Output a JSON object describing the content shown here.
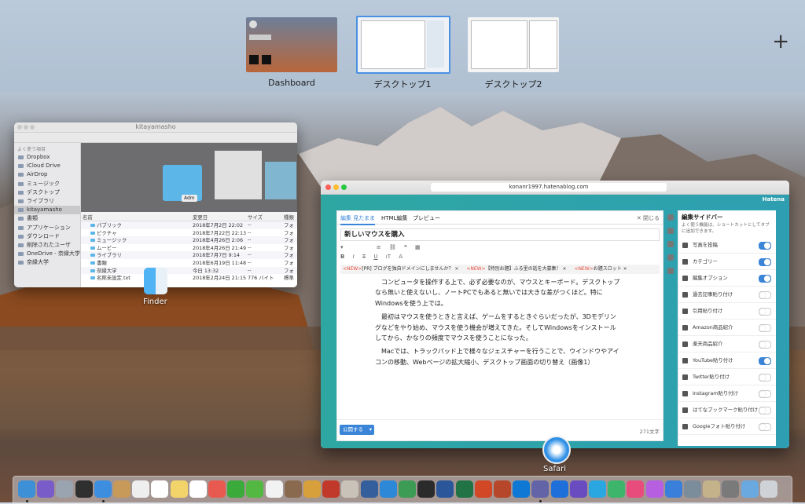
{
  "spaces": {
    "items": [
      {
        "label": "Dashboard"
      },
      {
        "label": "デスクトップ1"
      },
      {
        "label": "デスクトップ2"
      }
    ],
    "add_glyph": "+"
  },
  "finder": {
    "title": "kitayamasho",
    "sidebar_header": "よく使う項目",
    "sidebar": [
      "Dropbox",
      "iCloud Drive",
      "AirDrop",
      "ミュージック",
      "デスクトップ",
      "ライブラリ",
      "kitayamasho",
      "書類",
      "アプリケーション",
      "ダウンロード",
      "削除されたユーザ",
      "OneDrive - 奈縁大学",
      "奈縁大学"
    ],
    "preview_label": "Adm",
    "columns": [
      "名前",
      "変更日",
      "サイズ",
      "種類"
    ],
    "rows": [
      [
        "パブリック",
        "2018年7月2日 22:02",
        "--",
        "フォ"
      ],
      [
        "ピクチャ",
        "2018年7月22日 22:13",
        "--",
        "フォ"
      ],
      [
        "ミュージック",
        "2018年4月26日 2:06",
        "--",
        "フォ"
      ],
      [
        "ムービー",
        "2018年4月26日 21:49",
        "--",
        "フォ"
      ],
      [
        "ライブラリ",
        "2018年7月7日 9:14",
        "--",
        "フォ"
      ],
      [
        "書類",
        "2018年6月19日 11:48",
        "--",
        "フォ"
      ],
      [
        "奈縁大学",
        "今日 13:32",
        "--",
        "フォ"
      ],
      [
        "名称未設定.txt",
        "2018年2月24日 21:15",
        "776 バイト",
        "標準"
      ]
    ]
  },
  "app_labels": {
    "finder": "Finder",
    "safari": "Safari"
  },
  "safari": {
    "url": "konanr1997.hatenablog.com",
    "tab_brand": "Hatena",
    "editor": {
      "tabs": [
        "編集 見たまま",
        "HTML編集",
        "プレビュー"
      ],
      "close_label": "✕ 閉じる",
      "post_title": "新しいマウスを購入",
      "news": [
        {
          "tag": "<NEW>",
          "text": "[PR] ブログを独自ドメインにしませんか？ ×"
        },
        {
          "tag": "<NEW>",
          "text": "【特別お題】ふる里の話を大募集！ ×"
        },
        {
          "tag": "<NEW>",
          "text": "お題スロット ×"
        }
      ],
      "paragraphs": [
        "コンピュータを操作する上で、必ず必要なのが、マウスとキーボード。デスクトップなら無いと使えないし、ノートPCでもあると無いでは大きな差がつくほど。特にWindowsを使う上では。",
        "最初はマウスを使うときと言えば、ゲームをするときぐらいだったが、3Dモデリングなどをやり始め、マウスを使う機会が増えてきた。そしてWindowsをインストールしてから、かなりの頻度でマウスを使うことになった。",
        "Macでは、トラックパッド上で様々なジェスチャーを行うことで、ウインドウやアイコンの移動、Webページの拡大縮小、デスクトップ画面の切り替え（画像1）"
      ],
      "publish_label": "公開する",
      "word_count": "271文字"
    },
    "sidebar": {
      "title": "編集サイドバー",
      "note": "よく使う機能は、ショートカットとしてタブに追加できます。",
      "items": [
        {
          "label": "写真を投稿",
          "on": true
        },
        {
          "label": "カテゴリー",
          "on": true
        },
        {
          "label": "編集オプション",
          "on": true
        },
        {
          "label": "過去記事貼り付け",
          "on": false
        },
        {
          "label": "引用貼り付け",
          "on": false
        },
        {
          "label": "Amazon商品紹介",
          "on": false
        },
        {
          "label": "楽天商品紹介",
          "on": false
        },
        {
          "label": "YouTube貼り付け",
          "on": true
        },
        {
          "label": "Twitter貼り付け",
          "on": false
        },
        {
          "label": "Instagram貼り付け",
          "on": false
        },
        {
          "label": "はてなブックマーク貼り付け",
          "on": false
        },
        {
          "label": "Googleフォト貼り付け",
          "on": false
        }
      ]
    }
  },
  "dock": {
    "colors": [
      "#3d8fd6",
      "#7a5cc9",
      "#9aa3b0",
      "#2f2f2f",
      "#3e8ee0",
      "#c79a5a",
      "#eeeeee",
      "#ffffff",
      "#f3d46b",
      "#ffffff",
      "#e85a4f",
      "#3aaa3a",
      "#52b842",
      "#f2f2f2",
      "#8a6a4f",
      "#d8a03a",
      "#c0392b",
      "#c8c2b8",
      "#355e9c",
      "#2d88d8",
      "#3c9b54",
      "#2b2b2b",
      "#2b579a",
      "#217346",
      "#d24726",
      "#b7472a",
      "#0f78d4",
      "#6264a7",
      "#1e6fd9",
      "#6a4cc1",
      "#2aa7e0",
      "#3db56a",
      "#e74c7c",
      "#b65fe0",
      "#3a7fd9",
      "#7b8c9a",
      "#c4b28a",
      "#7a7a7a",
      "#6aa9e0",
      "#cfd2d6"
    ]
  }
}
